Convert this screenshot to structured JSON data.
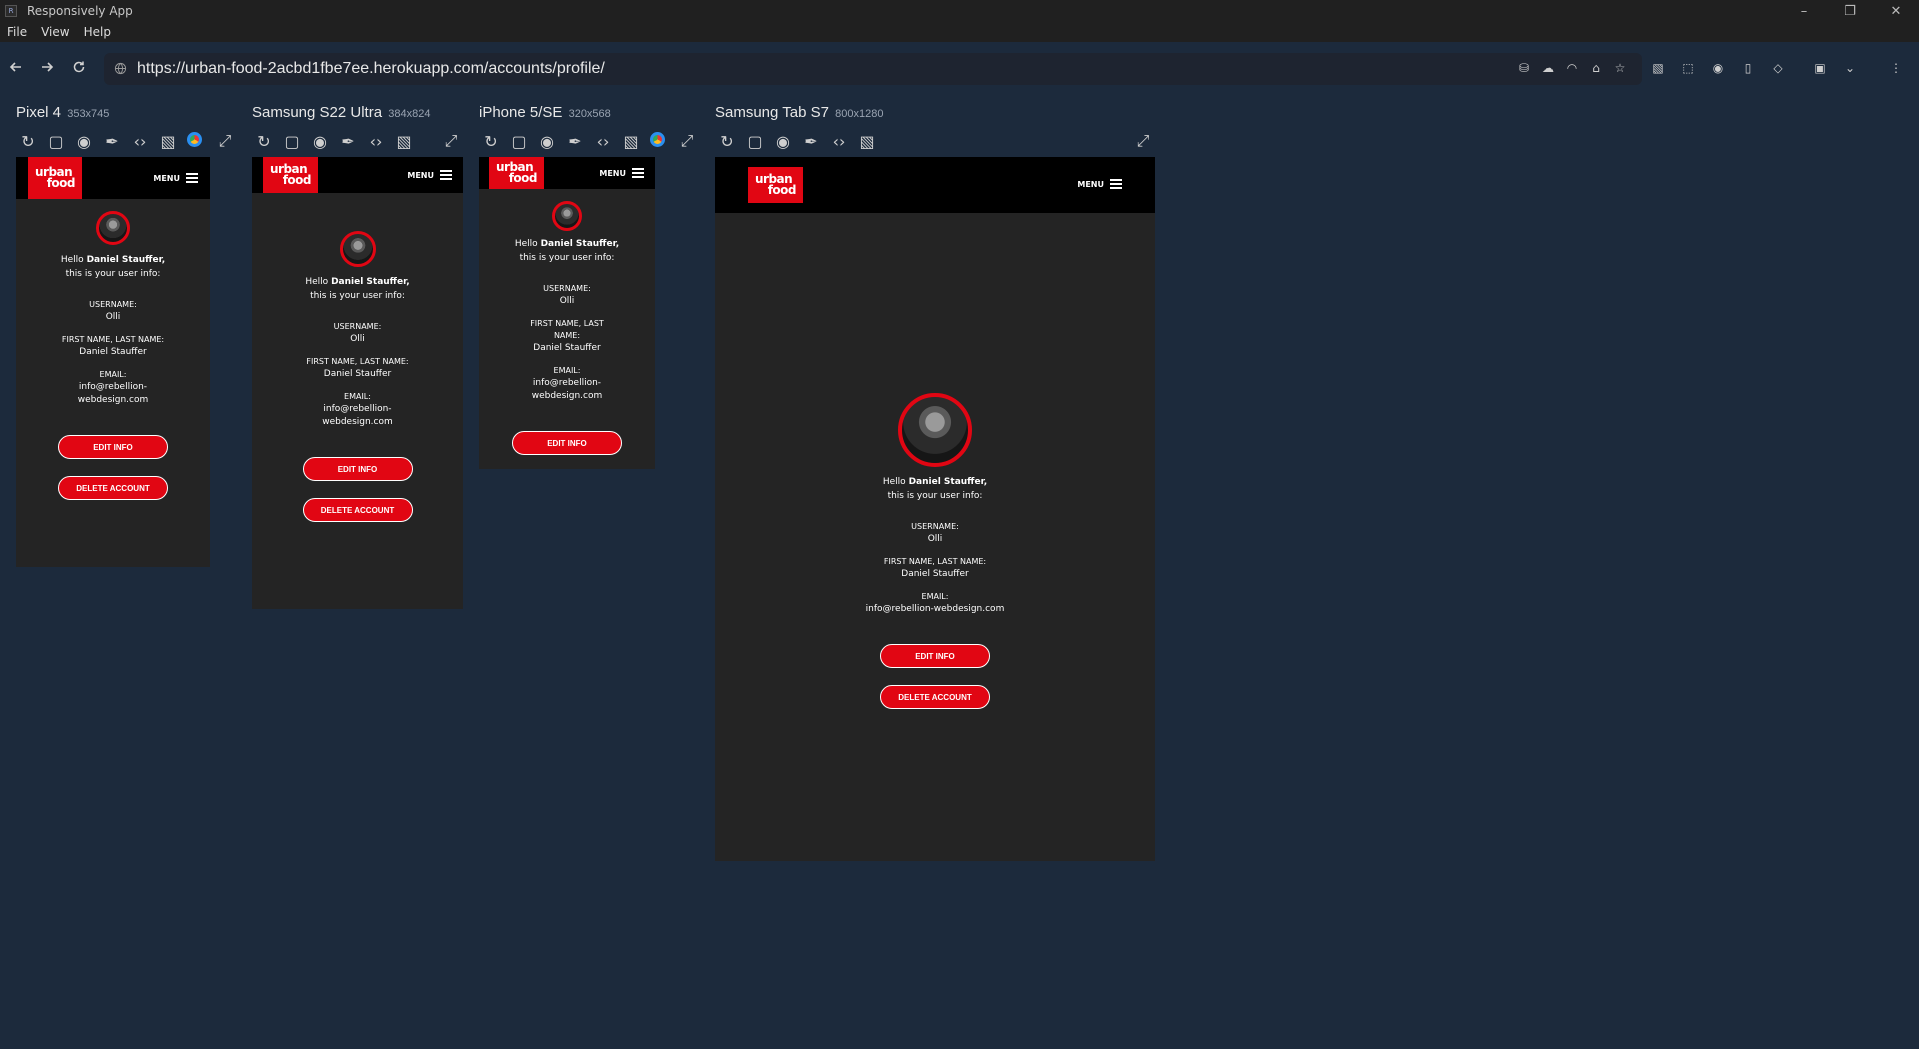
{
  "window": {
    "title": "Responsively App",
    "icon": "R"
  },
  "menu": [
    "File",
    "View",
    "Help"
  ],
  "address": {
    "url": "https://urban-food-2acbd1fbe7ee.herokuapp.com/accounts/profile/"
  },
  "devices": [
    {
      "name": "Pixel 4",
      "dims": "353x745"
    },
    {
      "name": "Samsung S22 Ultra",
      "dims": "384x824"
    },
    {
      "name": "iPhone 5/SE",
      "dims": "320x568"
    },
    {
      "name": "Samsung Tab S7",
      "dims": "800x1280"
    }
  ],
  "site": {
    "logo_line1": "urban",
    "logo_line2": "food",
    "menu_label": "MENU",
    "hello": "Hello",
    "user_fullname": "Daniel Stauffer,",
    "info_line": "this is your user info:",
    "username_label": "USERNAME:",
    "username_value": "Olli",
    "name_label": "FIRST NAME, LAST NAME:",
    "name_value": "Daniel Stauffer",
    "email_label": "EMAIL:",
    "email_value": "info@rebellion-webdesign.com",
    "edit_button": "EDIT INFO",
    "delete_button": "DELETE ACCOUNT"
  },
  "colors": {
    "brand_red": "#e10613",
    "page_bg": "#1c2a3c",
    "site_bg": "#242424"
  }
}
